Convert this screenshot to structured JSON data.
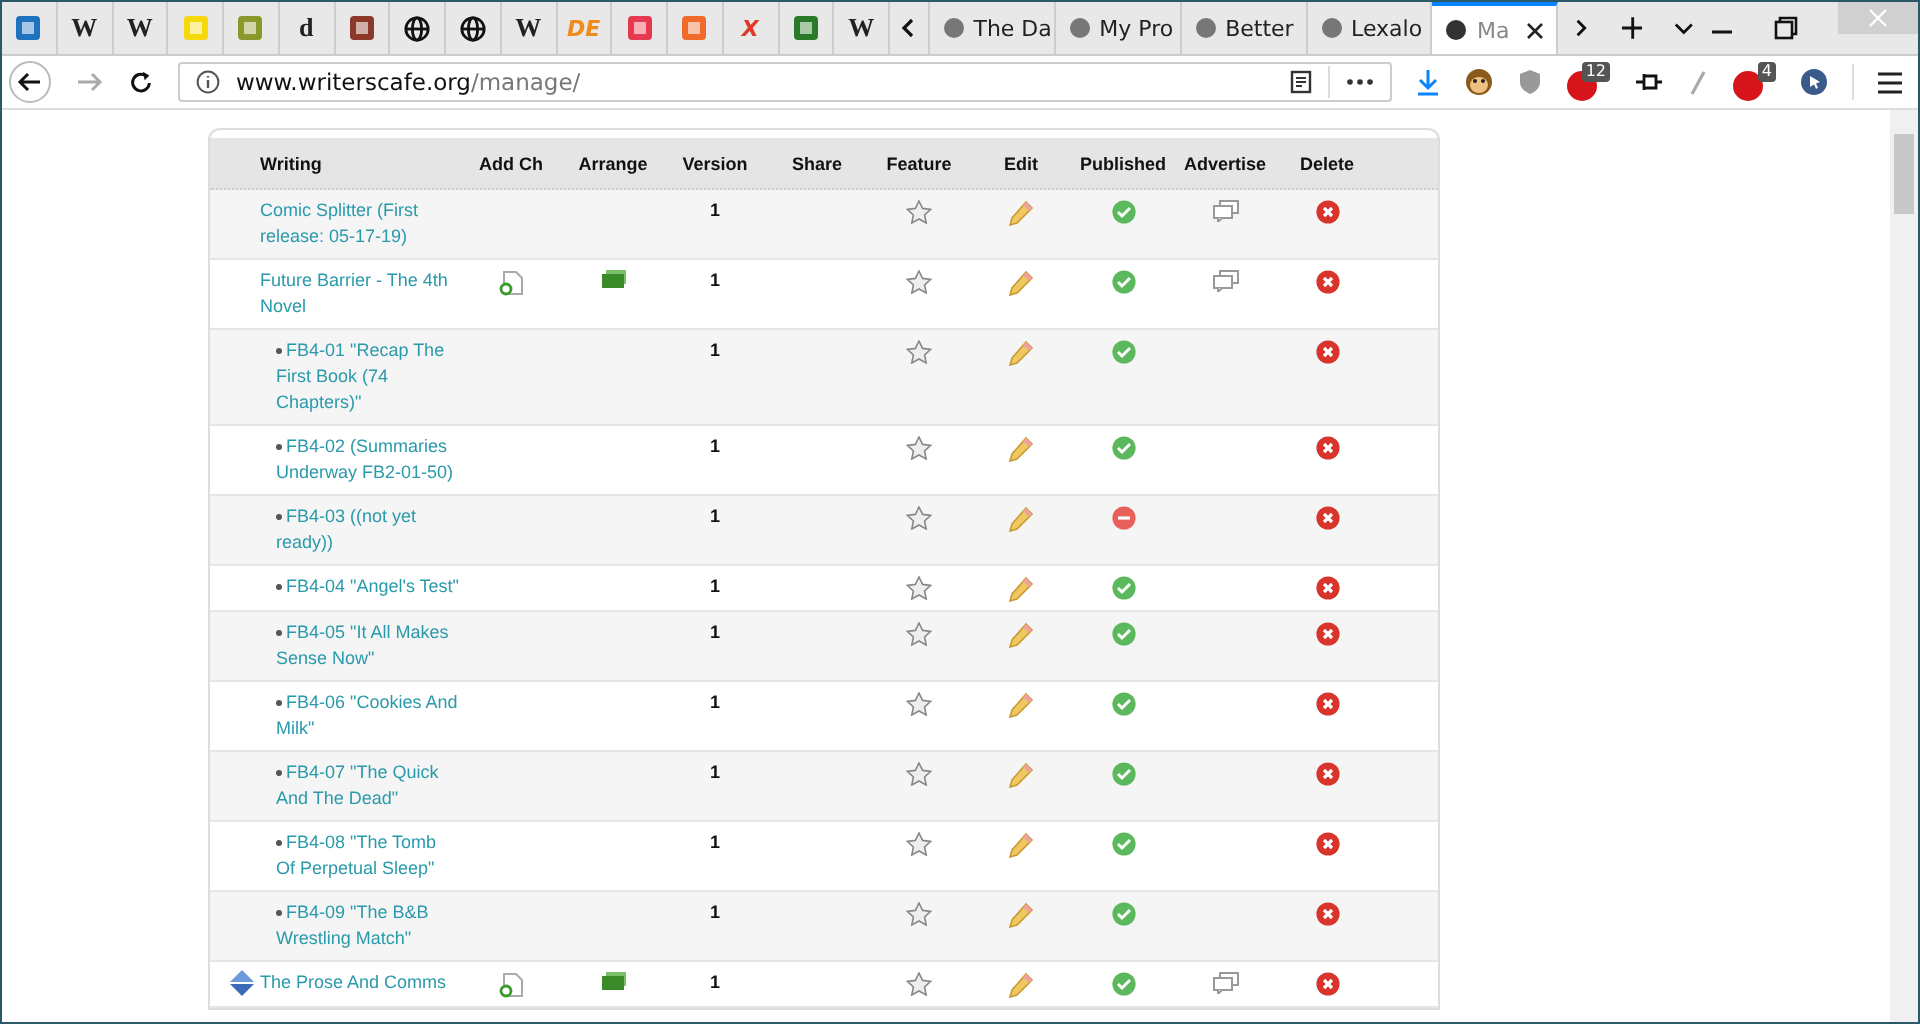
{
  "browser": {
    "pinned_tabs": [
      {
        "kind": "icon",
        "color": "#1e73be"
      },
      {
        "kind": "letter",
        "label": "W"
      },
      {
        "kind": "letter",
        "label": "W"
      },
      {
        "kind": "icon",
        "color": "#f5d90a"
      },
      {
        "kind": "icon",
        "color": "#8a9a2a"
      },
      {
        "kind": "letter",
        "label": "d"
      },
      {
        "kind": "icon",
        "color": "#8b3a2a"
      },
      {
        "kind": "globe"
      },
      {
        "kind": "globe"
      },
      {
        "kind": "letter",
        "label": "W"
      },
      {
        "kind": "letter",
        "label": "DE",
        "color": "#f08a1a"
      },
      {
        "kind": "icon",
        "color": "#e8384f"
      },
      {
        "kind": "icon",
        "color": "#f06a2a"
      },
      {
        "kind": "letter",
        "label": "X",
        "color": "#e23a2a"
      },
      {
        "kind": "icon",
        "color": "#2a7a2a"
      },
      {
        "kind": "letter",
        "label": "W"
      }
    ],
    "tabs": [
      {
        "label": "The Da",
        "selected": false
      },
      {
        "label": "My Pro",
        "selected": false
      },
      {
        "label": "Better",
        "selected": false
      },
      {
        "label": "Lexalo",
        "selected": false
      },
      {
        "label": "Ma",
        "selected": true
      }
    ],
    "url": {
      "domain": "www.writerscafe.org",
      "path": "/manage/"
    },
    "badges": [
      "12",
      "4"
    ]
  },
  "table": {
    "columns": [
      "Writing",
      "Add Ch",
      "Arrange",
      "Version",
      "Share",
      "Feature",
      "Edit",
      "Published",
      "Advertise",
      "Delete"
    ],
    "rows": [
      {
        "title": "Comic Splitter (First release: 05-17-19)",
        "child": false,
        "sortable": false,
        "add_ch": false,
        "arrange": false,
        "version": "1",
        "published": true,
        "advertise": true
      },
      {
        "title": "Future Barrier - The 4th Novel",
        "child": false,
        "sortable": false,
        "add_ch": true,
        "arrange": true,
        "version": "1",
        "published": true,
        "advertise": true
      },
      {
        "title": "FB4-01 \"Recap The First Book (74 Chapters)\"",
        "child": true,
        "sortable": false,
        "add_ch": false,
        "arrange": false,
        "version": "1",
        "published": true,
        "advertise": false
      },
      {
        "title": "FB4-02 (Summaries Underway FB2-01-50)",
        "child": true,
        "sortable": false,
        "add_ch": false,
        "arrange": false,
        "version": "1",
        "published": true,
        "advertise": false
      },
      {
        "title": "FB4-03 ((not yet ready))",
        "child": true,
        "sortable": false,
        "add_ch": false,
        "arrange": false,
        "version": "1",
        "published": false,
        "advertise": false
      },
      {
        "title": "FB4-04 \"Angel's Test\"",
        "child": true,
        "sortable": false,
        "add_ch": false,
        "arrange": false,
        "version": "1",
        "published": true,
        "advertise": false
      },
      {
        "title": "FB4-05 \"It All Makes Sense Now\"",
        "child": true,
        "sortable": false,
        "add_ch": false,
        "arrange": false,
        "version": "1",
        "published": true,
        "advertise": false
      },
      {
        "title": "FB4-06 \"Cookies And Milk\"",
        "child": true,
        "sortable": false,
        "add_ch": false,
        "arrange": false,
        "version": "1",
        "published": true,
        "advertise": false
      },
      {
        "title": "FB4-07 \"The Quick And The Dead\"",
        "child": true,
        "sortable": false,
        "add_ch": false,
        "arrange": false,
        "version": "1",
        "published": true,
        "advertise": false
      },
      {
        "title": "FB4-08 \"The Tomb Of Perpetual Sleep\"",
        "child": true,
        "sortable": false,
        "add_ch": false,
        "arrange": false,
        "version": "1",
        "published": true,
        "advertise": false
      },
      {
        "title": "FB4-09 \"The B&B Wrestling Match\"",
        "child": true,
        "sortable": false,
        "add_ch": false,
        "arrange": false,
        "version": "1",
        "published": true,
        "advertise": false
      },
      {
        "title": "The Prose And Comms",
        "child": false,
        "sortable": true,
        "add_ch": true,
        "arrange": true,
        "version": "1",
        "published": true,
        "advertise": true
      }
    ]
  }
}
